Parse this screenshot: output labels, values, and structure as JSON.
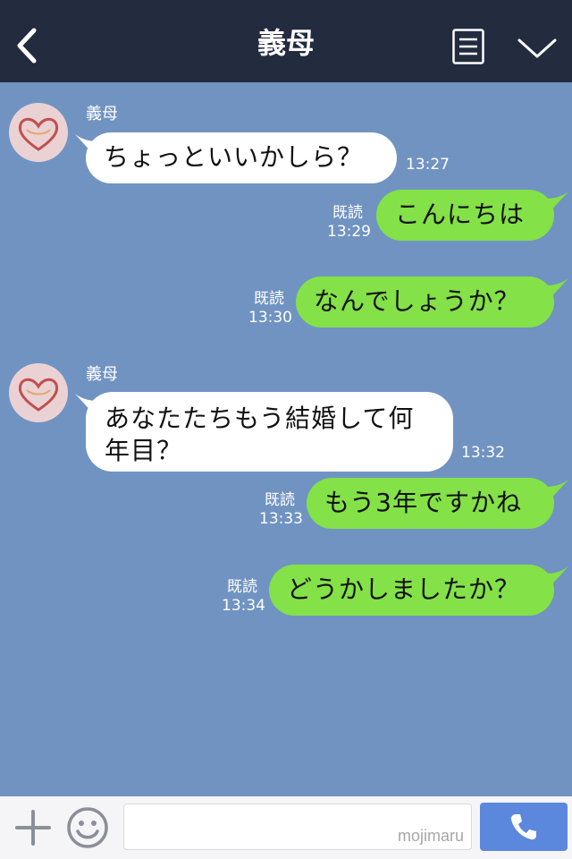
{
  "header": {
    "title": "義母",
    "back_icon": "chevron-left-icon",
    "menu_icon": "list-icon",
    "collapse_icon": "chevron-down-icon"
  },
  "messages": [
    {
      "from": "義母",
      "direction": "in",
      "text": "ちょっといいかしら？",
      "time": "13:27"
    },
    {
      "direction": "out",
      "text": "こんにちは",
      "read": "既読",
      "time": "13:29"
    },
    {
      "direction": "out",
      "text": "なんでしょうか？",
      "read": "既読",
      "time": "13:30"
    },
    {
      "from": "義母",
      "direction": "in",
      "text_line1": "あなたたちもう結婚して何",
      "text_line2": "年目？",
      "time": "13:32"
    },
    {
      "direction": "out",
      "text": "もう3年ですかね",
      "read": "既読",
      "time": "13:33"
    },
    {
      "direction": "out",
      "text": "どうかしましたか？",
      "read": "既読",
      "time": "13:34"
    }
  ],
  "footer": {
    "plus_icon": "plus-icon",
    "emoji_icon": "smiley-icon",
    "input_value": "",
    "watermark": "mojimaru",
    "call_icon": "phone-icon"
  },
  "colors": {
    "background": "#7093c2",
    "header": "#232b3f",
    "incoming_bubble": "#ffffff",
    "outgoing_bubble": "#84e147",
    "call_button": "#5b87dd"
  }
}
